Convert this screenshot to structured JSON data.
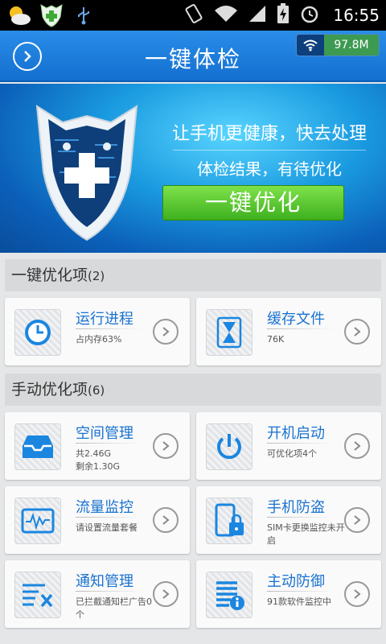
{
  "status_bar": {
    "time": "16:55"
  },
  "header": {
    "title": "一键体检",
    "traffic": "97.8M"
  },
  "banner": {
    "line1": "让手机更健康，快去处理",
    "line2": "体检结果，有待优化",
    "button": "一键优化"
  },
  "one_key": {
    "title": "一键优化项",
    "count": "(2)",
    "items": [
      {
        "title": "运行进程",
        "sub1": "占内存63%",
        "sub2": ""
      },
      {
        "title": "缓存文件",
        "sub1": "76K",
        "sub2": ""
      }
    ]
  },
  "manual": {
    "title": "手动优化项",
    "count": "(6)",
    "items": [
      {
        "title": "空间管理",
        "sub1": "共2.46G",
        "sub2": "剩余1.30G"
      },
      {
        "title": "开机启动",
        "sub1": "可优化项4个",
        "sub2": ""
      },
      {
        "title": "流量监控",
        "sub1": "请设置流量套餐",
        "sub2": ""
      },
      {
        "title": "手机防盗",
        "sub1": "SIM卡更换监控未开启",
        "sub2": ""
      },
      {
        "title": "通知管理",
        "sub1": "已拦截通知栏广告0个",
        "sub2": ""
      },
      {
        "title": "主动防御",
        "sub1": "91款软件监控中",
        "sub2": ""
      }
    ]
  },
  "colors": {
    "accent": "#1a72d0",
    "header": "#2a8de8",
    "button": "#4cbd2a"
  }
}
